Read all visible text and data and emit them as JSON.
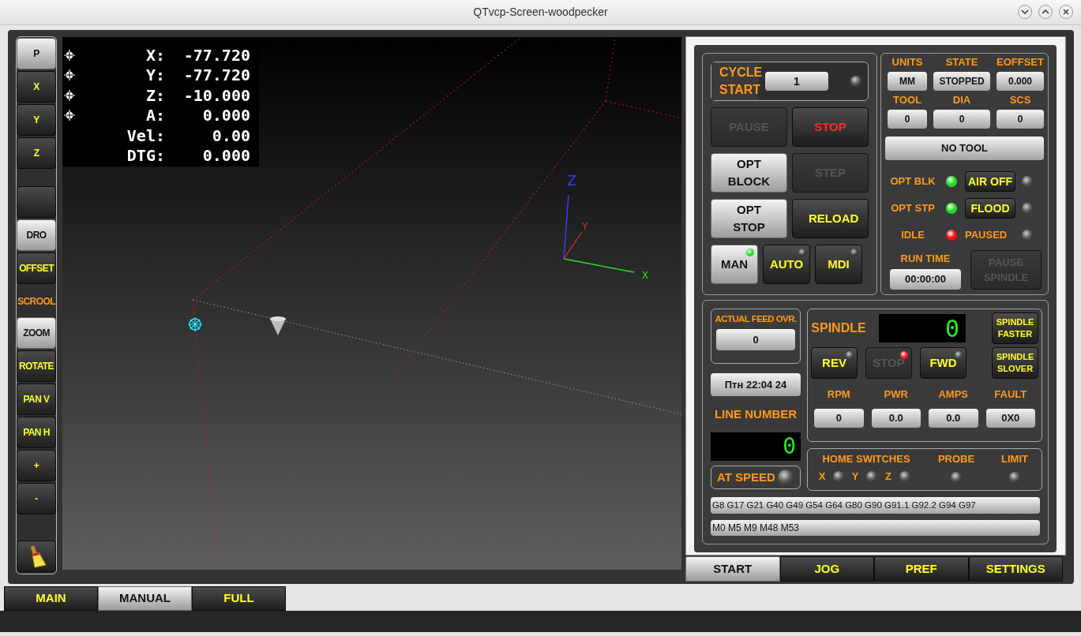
{
  "window": {
    "title": "QTvcp-Screen-woodpecker"
  },
  "sidebar": {
    "groups": [
      [
        {
          "kind": "button",
          "label": "P",
          "selected": true
        },
        {
          "kind": "button",
          "label": "X",
          "selected": false
        },
        {
          "kind": "button",
          "label": "Y",
          "selected": false
        },
        {
          "kind": "button",
          "label": "Z",
          "selected": false
        }
      ],
      [
        {
          "kind": "blank",
          "selected": false
        },
        {
          "kind": "button",
          "label": "DRO",
          "selected": true
        },
        {
          "kind": "button",
          "label": "OFFSET",
          "selected": false
        },
        {
          "kind": "label",
          "label": "SCROOL"
        },
        {
          "kind": "button",
          "label": "ZOOM",
          "selected": true
        },
        {
          "kind": "button",
          "label": "ROTATE",
          "selected": false
        },
        {
          "kind": "button",
          "label": "PAN V",
          "selected": false
        },
        {
          "kind": "button",
          "label": "PAN H",
          "selected": false
        },
        {
          "kind": "button",
          "label": "+",
          "selected": false
        },
        {
          "kind": "button",
          "label": "-",
          "selected": false
        }
      ],
      [
        {
          "kind": "icon",
          "selected": false
        }
      ]
    ]
  },
  "dro": [
    {
      "axis": "X:",
      "value": "-77.720",
      "homed": true
    },
    {
      "axis": "Y:",
      "value": "-77.720",
      "homed": true
    },
    {
      "axis": "Z:",
      "value": "-10.000",
      "homed": true
    },
    {
      "axis": "A:",
      "value": "0.000",
      "homed": true
    },
    {
      "axis": "Vel:",
      "value": "0.00",
      "homed": false
    },
    {
      "axis": "DTG:",
      "value": "0.000",
      "homed": false
    }
  ],
  "view_axes": [
    "X",
    "Y",
    "Z"
  ],
  "program": {
    "cycle_label": "CYCLE START",
    "cycle_value": "1",
    "cycle_led": {
      "on": false
    },
    "buttons": [
      {
        "label": "PAUSE",
        "checked": false,
        "disabled": true
      },
      {
        "label": "STOP",
        "checked": false,
        "disabled": false,
        "color": "#ff2a2a"
      },
      {
        "label": "OPT BLOCK",
        "checked": true,
        "disabled": false
      },
      {
        "label": "STEP",
        "checked": false,
        "disabled": true
      },
      {
        "label": "OPT STOP",
        "checked": true,
        "disabled": false
      },
      {
        "label": "RELOAD",
        "checked": false,
        "disabled": false
      }
    ],
    "modes": [
      {
        "label": "MAN",
        "selected": true
      },
      {
        "label": "AUTO",
        "selected": false
      },
      {
        "label": "MDI",
        "selected": false
      }
    ]
  },
  "status": {
    "fields": [
      {
        "label": "UNITS",
        "value": "MM"
      },
      {
        "label": "STATE",
        "value": "STOPPED"
      },
      {
        "label": "EOFFSET",
        "value": "0.000"
      },
      {
        "label": "TOOL",
        "value": "0"
      },
      {
        "label": "DIA",
        "value": "0"
      },
      {
        "label": "SCS",
        "value": "0"
      }
    ],
    "tool_name": "NO TOOL",
    "indicators": [
      {
        "label": "OPT BLK",
        "on": true,
        "color": "#22dd22"
      },
      {
        "label": "OPT STP",
        "on": true,
        "color": "#22dd22"
      },
      {
        "label": "IDLE",
        "on": true,
        "color": "#ee1111"
      }
    ],
    "coolant": [
      {
        "kind": "button",
        "label": "AIR OFF",
        "on": false
      },
      {
        "kind": "button",
        "label": "FLOOD",
        "on": false
      },
      {
        "kind": "label",
        "label": "PAUSED",
        "on": false
      }
    ],
    "run_time_label": "RUN TIME",
    "run_time": "00:00:00",
    "pause_spindle": {
      "label": "PAUSE SPINDLE",
      "disabled": true
    }
  },
  "spindle_panel": {
    "feed_label": "ACTUAL FEED OVR.",
    "feed_value": "0",
    "clock": "Птн 22:04 24",
    "line_label": "LINE NUMBER",
    "line_number": "0",
    "at_speed_label": "AT SPEED",
    "at_speed": {
      "on": false
    },
    "spindle_label": "SPINDLE",
    "spindle_speed": "0",
    "faster": "SPINDLE FASTER",
    "slower": "SPINDLE SLOVER",
    "dir_buttons": [
      {
        "label": "REV",
        "disabled": false,
        "led": {
          "on": false
        }
      },
      {
        "label": "STOP",
        "disabled": true,
        "led": {
          "on": true,
          "color": "#ff2020"
        }
      },
      {
        "label": "FWD",
        "disabled": false,
        "led": {
          "on": false
        }
      }
    ],
    "readouts": [
      {
        "label": "RPM",
        "value": "0"
      },
      {
        "label": "PWR",
        "value": "0.0"
      },
      {
        "label": "AMPS",
        "value": "0.0"
      },
      {
        "label": "FAULT",
        "value": "0X0"
      }
    ],
    "home_label": "HOME SWITCHES",
    "home": [
      {
        "axis": "X",
        "on": false
      },
      {
        "axis": "Y",
        "on": false
      },
      {
        "axis": "Z",
        "on": false
      }
    ],
    "probe": {
      "label": "PROBE",
      "on": false
    },
    "limit": {
      "label": "LIMIT",
      "on": false
    },
    "gcodes": "G8 G17 G21 G40 G49 G54 G64 G80 G90 G91.1 G92.2 G94 G97",
    "mcodes": "M0 M5 M9 M48 M53"
  },
  "panel_tabs": [
    {
      "label": "START",
      "selected": true
    },
    {
      "label": "JOG",
      "selected": false
    },
    {
      "label": "PREF",
      "selected": false
    },
    {
      "label": "SETTINGS",
      "selected": false
    }
  ],
  "main_tabs": [
    {
      "label": "MAIN",
      "selected": false
    },
    {
      "label": "MANUAL",
      "selected": true
    },
    {
      "label": "FULL",
      "selected": false
    }
  ]
}
